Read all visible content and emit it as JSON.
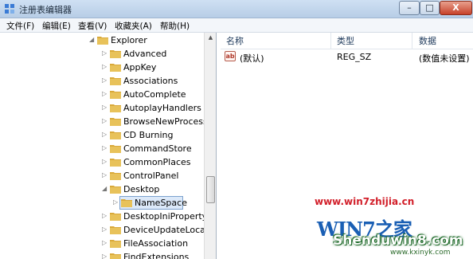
{
  "window": {
    "title": "注册表编辑器",
    "min_label": "–",
    "max_label": "□",
    "close_label": "X"
  },
  "menu": [
    "文件(F)",
    "编辑(E)",
    "查看(V)",
    "收藏夹(A)",
    "帮助(H)"
  ],
  "tree": {
    "parent": {
      "label": "Explorer",
      "expanded": true
    },
    "items": [
      {
        "label": "Advanced",
        "expanded": false
      },
      {
        "label": "AppKey",
        "expanded": false
      },
      {
        "label": "Associations",
        "expanded": false
      },
      {
        "label": "AutoComplete",
        "expanded": false
      },
      {
        "label": "AutoplayHandlers",
        "expanded": false
      },
      {
        "label": "BrowseNewProcess",
        "expanded": false
      },
      {
        "label": "CD Burning",
        "expanded": false
      },
      {
        "label": "CommandStore",
        "expanded": false
      },
      {
        "label": "CommonPlaces",
        "expanded": false
      },
      {
        "label": "ControlPanel",
        "expanded": false
      },
      {
        "label": "Desktop",
        "expanded": true
      },
      {
        "label": "NameSpace",
        "expanded": false,
        "selected": true,
        "child": true
      },
      {
        "label": "DesktopIniPropertyM",
        "expanded": false
      },
      {
        "label": "DeviceUpdateLocatic",
        "expanded": false
      },
      {
        "label": "FileAssociation",
        "expanded": false
      },
      {
        "label": "FindExtensions",
        "expanded": false
      }
    ]
  },
  "list": {
    "columns": [
      "名称",
      "类型",
      "数据"
    ],
    "rows": [
      {
        "name": "(默认)",
        "type": "REG_SZ",
        "data": "(数值未设置)"
      }
    ]
  },
  "watermark": {
    "url": "www.win7zhijia.cn",
    "logo": "WIN7之家",
    "brand": "Shenduwin8.com",
    "site": "www.kxinyk.com"
  },
  "colors": {
    "selected_bg": "#dce9f9",
    "folder": "#e8c25a",
    "watermark_red": "#d21f2a"
  }
}
